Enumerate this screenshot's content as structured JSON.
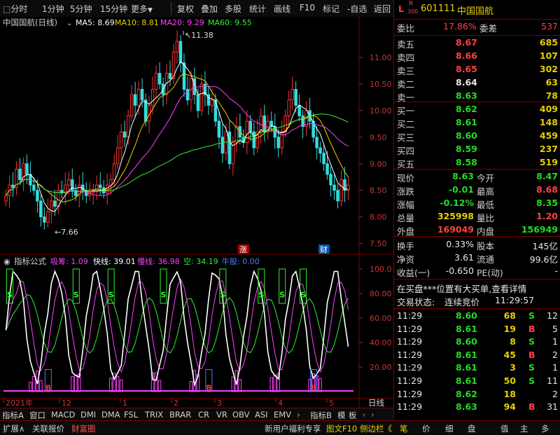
{
  "toolbar": {
    "items": [
      "分时",
      "1分钟",
      "5分钟",
      "15分钟",
      "更多",
      "复权",
      "叠加",
      "多股",
      "统计",
      "画线",
      "F10",
      "标记",
      "自选",
      "返回"
    ]
  },
  "chart": {
    "title": "中国国航(日线)",
    "ma": [
      {
        "label": "MA5: 8.69",
        "color": "#ffffff"
      },
      {
        "label": "MA10: 8.81",
        "color": "#e8d000"
      },
      {
        "label": "MA20: 9.29",
        "color": "#ff40ff"
      },
      {
        "label": "MA60: 9.55",
        "color": "#33ee33"
      }
    ],
    "high_label": "11.38",
    "low_label": "7.66",
    "zhang_tag": "涨",
    "cai_tag": "财",
    "price_ticks": [
      "11.00",
      "10.50",
      "10.00",
      "9.50",
      "9.00",
      "8.50",
      "8.00",
      "7.50"
    ],
    "indicator": {
      "name": "指标公式",
      "items": [
        {
          "label": "吸筹: 1.09",
          "color": "#ff40ff"
        },
        {
          "label": "快线: 39.01",
          "color": "#ffffff"
        },
        {
          "label": "慢线: 36.98",
          "color": "#ff40ff"
        },
        {
          "label": "空: 34.19",
          "color": "#33ee33"
        },
        {
          "label": "牛股: 0.00",
          "color": "#4a7cff"
        }
      ],
      "ticks": [
        "100.0",
        "80.00",
        "60.00",
        "40.00",
        "20.00"
      ],
      "s_mark": "S",
      "b_mark": "B"
    },
    "date_labels": [
      "2021年",
      "12",
      "1",
      "2",
      "3",
      "4",
      "5"
    ],
    "period": "日线"
  },
  "bottom_tabs": [
    "指标A",
    "窗口",
    "MACD",
    "DMI",
    "DMA",
    "FSL",
    "TRIX",
    "BRAR",
    "CR",
    "VR",
    "OBV",
    "ASI",
    "EMV",
    "指标B",
    "模",
    "板"
  ],
  "status_bar": {
    "left": [
      "扩展∧",
      "关联报价",
      "财富圈"
    ],
    "right": [
      "新用户福利专享",
      "图文F10",
      "侧边栏《"
    ],
    "panel_tabs": [
      "笔",
      "价",
      "细",
      "盘",
      "值",
      "主",
      "多"
    ]
  },
  "quote": {
    "badge_l": "L",
    "badge_r": "R",
    "badge_num": "300",
    "code": "601111",
    "name": "中国国航",
    "webi": {
      "label": "委比",
      "value": "17.86%",
      "label2": "委差",
      "value2": "537"
    },
    "sell": [
      {
        "label": "卖五",
        "price": "8.67",
        "vol": "685"
      },
      {
        "label": "卖四",
        "price": "8.66",
        "vol": "107"
      },
      {
        "label": "卖三",
        "price": "8.65",
        "vol": "302"
      },
      {
        "label": "卖二",
        "price": "8.64",
        "vol": "63"
      },
      {
        "label": "卖一",
        "price": "8.63",
        "vol": "78"
      }
    ],
    "buy": [
      {
        "label": "买一",
        "price": "8.62",
        "vol": "409"
      },
      {
        "label": "买二",
        "price": "8.61",
        "vol": "148"
      },
      {
        "label": "买三",
        "price": "8.60",
        "vol": "459"
      },
      {
        "label": "买四",
        "price": "8.59",
        "vol": "237"
      },
      {
        "label": "买五",
        "price": "8.58",
        "vol": "519"
      }
    ],
    "stats": [
      {
        "l1": "现价",
        "v1": "8.63",
        "c1": "grn",
        "l2": "今开",
        "v2": "8.47",
        "c2": "grn"
      },
      {
        "l1": "涨跌",
        "v1": "-0.01",
        "c1": "grn",
        "l2": "最高",
        "v2": "8.68",
        "c2": "red"
      },
      {
        "l1": "涨幅",
        "v1": "-0.12%",
        "c1": "grn",
        "l2": "最低",
        "v2": "8.35",
        "c2": "grn"
      },
      {
        "l1": "总量",
        "v1": "325998",
        "c1": "yel",
        "l2": "量比",
        "v2": "1.20",
        "c2": "red"
      },
      {
        "l1": "外盘",
        "v1": "169049",
        "c1": "red",
        "l2": "内盘",
        "v2": "156949",
        "c2": "grn"
      }
    ],
    "stats2": [
      {
        "l1": "换手",
        "v1": "0.33%",
        "l2": "股本",
        "v2": "145亿"
      },
      {
        "l1": "净资",
        "v1": "3.61",
        "l2": "流通",
        "v2": "99.6亿"
      },
      {
        "l1": "收益(一)",
        "v1": "-0.650",
        "l2": "PE(动)",
        "v2": "-"
      }
    ],
    "notice": "在买盘***位置有大买单,查看详情",
    "trade_state_label": "交易状态:",
    "trade_state": "连续竞价",
    "trade_time": "11:29:57",
    "ticks": [
      {
        "t": "11:29",
        "p": "8.60",
        "v": "68",
        "d": "S",
        "n": "12"
      },
      {
        "t": "11:29",
        "p": "8.61",
        "v": "19",
        "d": "B",
        "n": "5"
      },
      {
        "t": "11:29",
        "p": "8.60",
        "v": "8",
        "d": "S",
        "n": "1"
      },
      {
        "t": "11:29",
        "p": "8.61",
        "v": "45",
        "d": "B",
        "n": "2"
      },
      {
        "t": "11:29",
        "p": "8.61",
        "v": "3",
        "d": "S",
        "n": "1"
      },
      {
        "t": "11:29",
        "p": "8.61",
        "v": "50",
        "d": "S",
        "n": "11"
      },
      {
        "t": "11:29",
        "p": "8.62",
        "v": "18",
        "d": "",
        "n": "2"
      },
      {
        "t": "11:29",
        "p": "8.63",
        "v": "94",
        "d": "B",
        "n": "31"
      }
    ]
  }
}
